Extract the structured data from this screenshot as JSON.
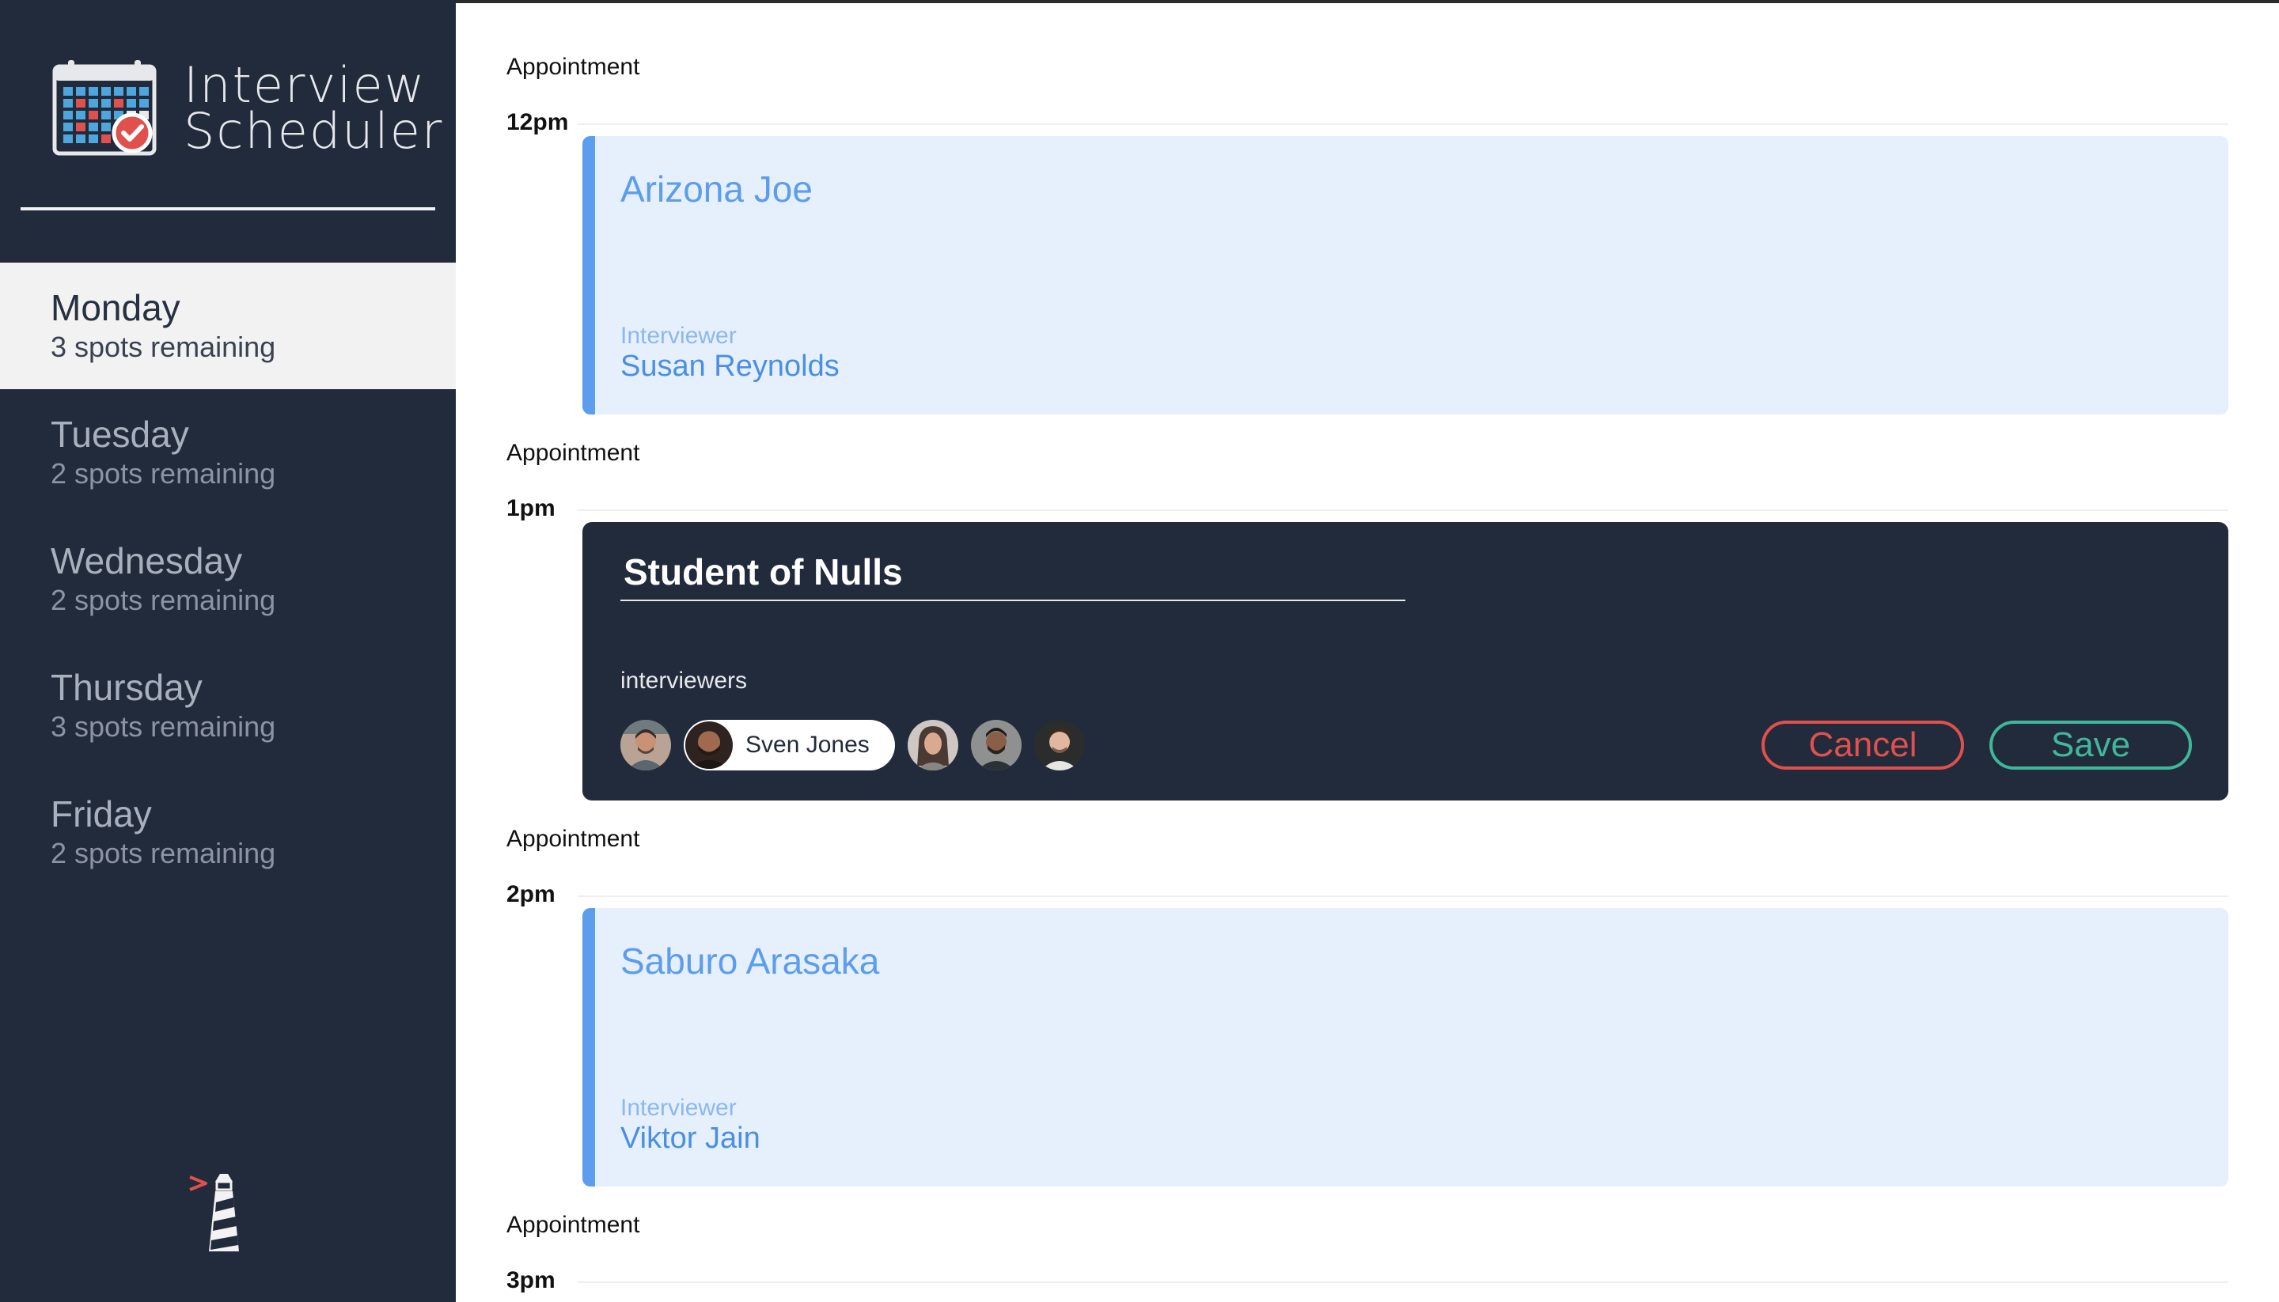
{
  "app": {
    "title_line1": "Interview",
    "title_line2": "Scheduler"
  },
  "sidebar": {
    "days": [
      {
        "name": "Monday",
        "spots": "3 spots remaining",
        "selected": true
      },
      {
        "name": "Tuesday",
        "spots": "2 spots remaining",
        "selected": false
      },
      {
        "name": "Wednesday",
        "spots": "2 spots remaining",
        "selected": false
      },
      {
        "name": "Thursday",
        "spots": "3 spots remaining",
        "selected": false
      },
      {
        "name": "Friday",
        "spots": "2 spots remaining",
        "selected": false
      }
    ]
  },
  "schedule": {
    "appointment_label": "Appointment",
    "slots": [
      {
        "time": "12pm",
        "mode": "show",
        "student": "Arizona Joe",
        "interviewer_caption": "Interviewer",
        "interviewer": "Susan Reynolds"
      },
      {
        "time": "1pm",
        "mode": "form",
        "student_input": "Student of Nulls",
        "interviewers_caption": "interviewers",
        "selected_interviewer": "Sven Jones",
        "cancel_label": "Cancel",
        "save_label": "Save"
      },
      {
        "time": "2pm",
        "mode": "show",
        "student": "Saburo Arasaka",
        "interviewer_caption": "Interviewer",
        "interviewer": "Viktor Jain"
      },
      {
        "time": "3pm",
        "mode": "empty"
      }
    ]
  },
  "colors": {
    "sidebar_bg": "#222b3b",
    "selected_day_bg": "#f2f2f2",
    "card_bg": "#e6f0fd",
    "card_accent": "#5c9ded",
    "cancel": "#e0504d",
    "save": "#3fb79b"
  },
  "icons": {
    "logo": "calendar-check-icon",
    "footer": "lighthouse-icon"
  }
}
